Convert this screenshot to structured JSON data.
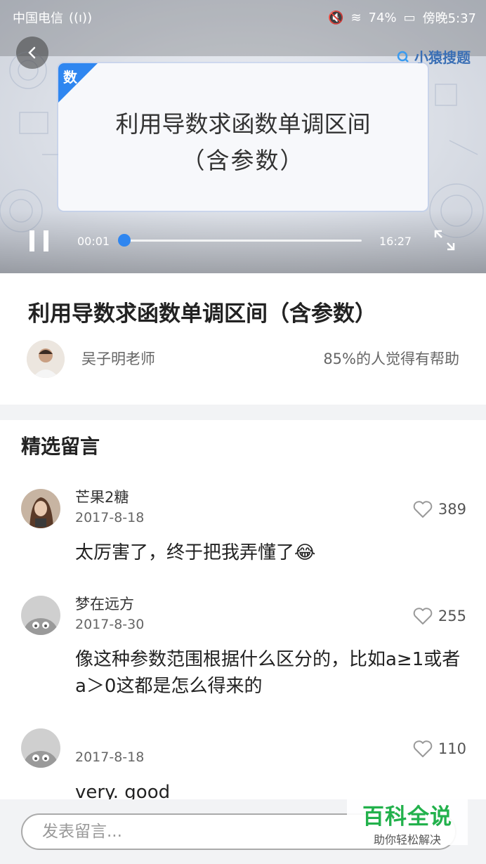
{
  "status_bar": {
    "carrier": "中国电信",
    "battery": "74%",
    "time": "傍晚5:37"
  },
  "video": {
    "brand": "小猿搜题",
    "subject_badge": "数",
    "card_title_line1": "利用导数求函数单调区间",
    "card_title_line2": "（含参数）",
    "current_time": "00:01",
    "total_time": "16:27",
    "progress": 0.001
  },
  "info": {
    "title": "利用导数求函数单调区间（含参数）",
    "teacher": "吴子明老师",
    "helpful": "85%的人觉得有帮助"
  },
  "comments": {
    "section_title": "精选留言",
    "items": [
      {
        "name": "芒果2糖",
        "date": "2017-8-18",
        "likes": "389",
        "text": "太厉害了，终于把我弄懂了😂"
      },
      {
        "name": "梦在远方",
        "date": "2017-8-30",
        "likes": "255",
        "text": "像这种参数范围根据什么区分的，比如a≥1或者a＞0这都是怎么得来的"
      },
      {
        "name": "",
        "date": "2017-8-18",
        "likes": "110",
        "text": "very. good"
      }
    ]
  },
  "bottom": {
    "placeholder": "发表留言..."
  },
  "watermark": {
    "title": "百科全说",
    "subtitle": "助你轻松解决"
  },
  "colors": {
    "accent": "#2f86f0",
    "watermark_green": "#22b14c"
  }
}
